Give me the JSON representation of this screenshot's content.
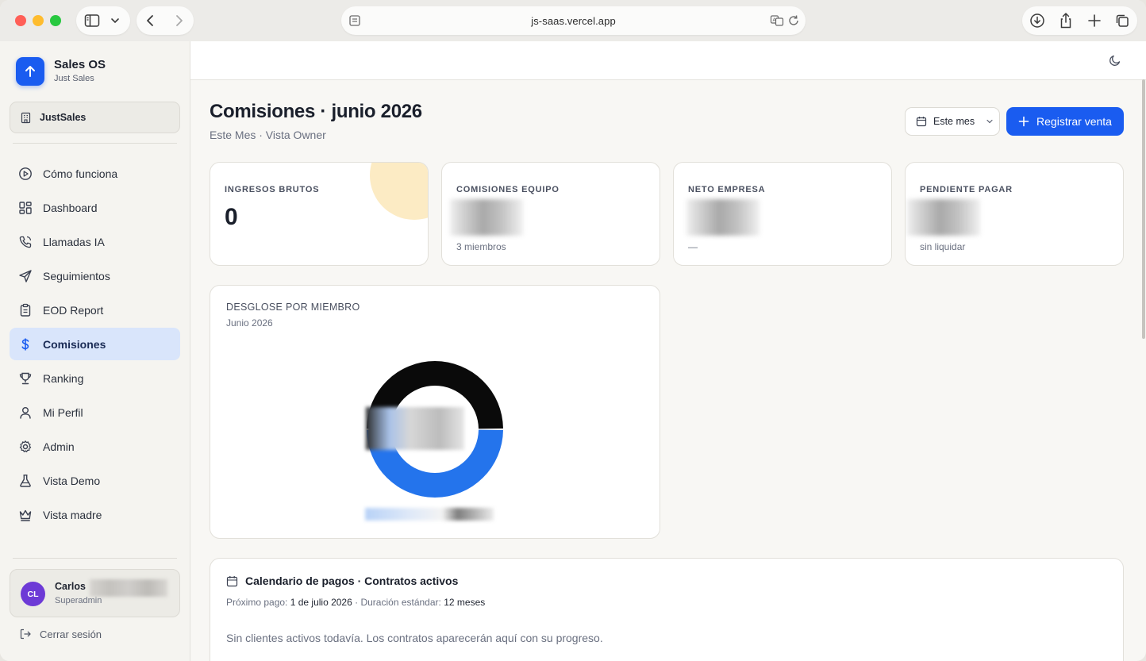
{
  "browser": {
    "url": "js-saas.vercel.app"
  },
  "sidebar": {
    "brand_name": "Sales OS",
    "brand_sub": "Just Sales",
    "org_name": "JustSales",
    "items": [
      {
        "label": "Cómo funciona",
        "icon": "play-circle-icon"
      },
      {
        "label": "Dashboard",
        "icon": "dashboard-icon"
      },
      {
        "label": "Llamadas IA",
        "icon": "phone-icon"
      },
      {
        "label": "Seguimientos",
        "icon": "send-icon"
      },
      {
        "label": "EOD Report",
        "icon": "clipboard-icon"
      },
      {
        "label": "Comisiones",
        "icon": "dollar-icon",
        "active": true
      },
      {
        "label": "Ranking",
        "icon": "trophy-icon"
      },
      {
        "label": "Mi Perfil",
        "icon": "user-icon"
      },
      {
        "label": "Admin",
        "icon": "gear-icon"
      },
      {
        "label": "Vista Demo",
        "icon": "flask-icon"
      },
      {
        "label": "Vista madre",
        "icon": "crown-icon"
      }
    ],
    "user": {
      "initials": "CL",
      "name": "Carlos",
      "role": "Superadmin"
    },
    "logout_label": "Cerrar sesión"
  },
  "header": {
    "title": "Comisiones · junio 2026",
    "subtitle": "Este Mes · Vista Owner",
    "period_label": "Este mes",
    "primary_button_label": "Registrar venta"
  },
  "stats": [
    {
      "label": "INGRESOS BRUTOS",
      "value": "0",
      "foot": ""
    },
    {
      "label": "COMISIONES EQUIPO",
      "value": "",
      "foot": "3 miembros"
    },
    {
      "label": "NETO EMPRESA",
      "value": "",
      "foot": "—"
    },
    {
      "label": "PENDIENTE PAGAR",
      "value": "",
      "foot": "sin liquidar"
    }
  ],
  "breakdown": {
    "title": "DESGLOSE POR MIEMBRO",
    "subtitle": "Junio 2026"
  },
  "chart_data": {
    "type": "pie",
    "values": [
      50,
      50
    ],
    "colors": [
      "#0a0a0a",
      "#2474ec"
    ]
  },
  "calendar": {
    "title": "Calendario de pagos · Contratos activos",
    "next_payment_label": "Próximo pago:",
    "next_payment_value": "1 de julio 2026",
    "duration_label": "· Duración estándar:",
    "duration_value": "12 meses",
    "empty_text": "Sin clientes activos todavía. Los contratos aparecerán aquí con su progreso."
  },
  "colors": {
    "accent": "#1a5cf0",
    "active_nav_bg": "#d9e5fb",
    "avatar": "#6d3ad6"
  }
}
